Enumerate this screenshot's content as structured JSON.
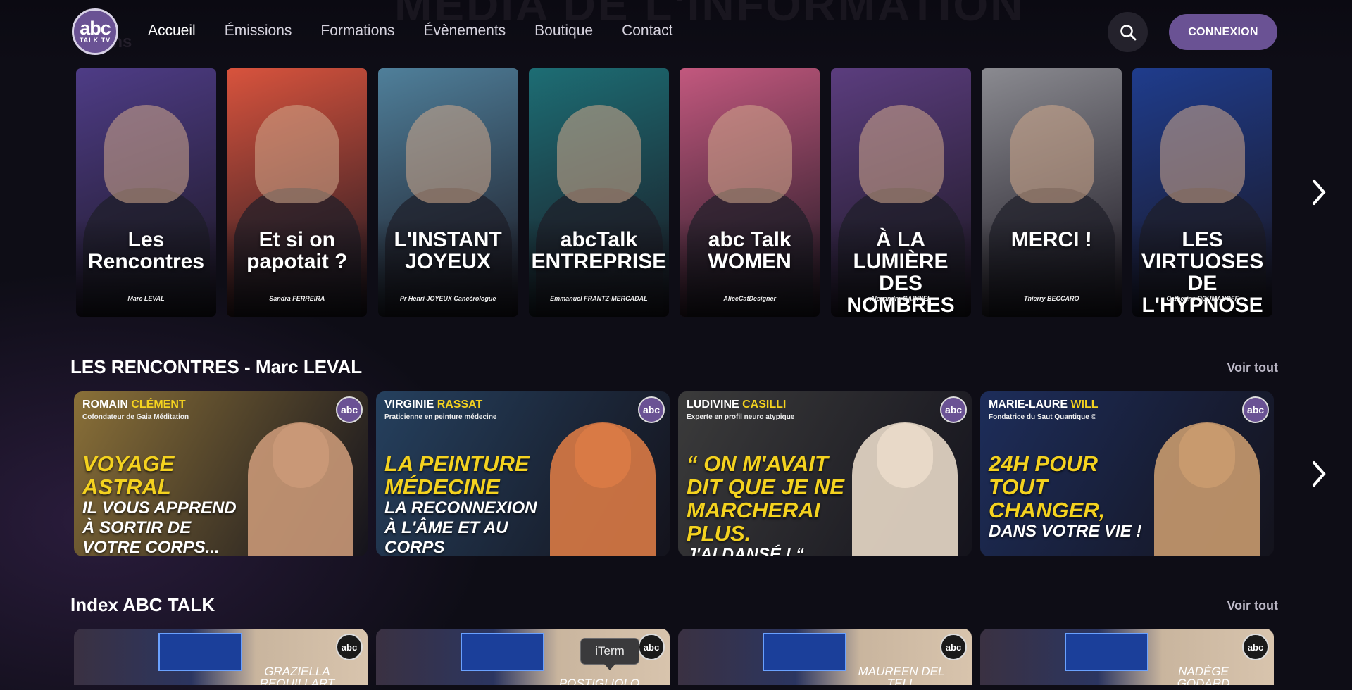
{
  "header": {
    "ghost_title": "MEDIA DE L'INFORMATION",
    "ghost_subtitle": "ions",
    "logo": {
      "main": "abc",
      "sub": "TALK TV"
    },
    "nav": [
      {
        "label": "Accueil",
        "active": true
      },
      {
        "label": "Émissions",
        "active": false
      },
      {
        "label": "Formations",
        "active": false
      },
      {
        "label": "Évènements",
        "active": false
      },
      {
        "label": "Boutique",
        "active": false
      },
      {
        "label": "Contact",
        "active": false
      }
    ],
    "search_icon": "search-icon",
    "login_label": "CONNEXION",
    "accent_color": "#6a5294"
  },
  "hosts": [
    {
      "show": "Les Rencontres",
      "host": "Marc LEVAL",
      "bg": "#4e3c86"
    },
    {
      "show": "Et si on papotait ?",
      "host": "Sandra FERREIRA",
      "bg": "#d8533d"
    },
    {
      "show": "L'INSTANT JOYEUX",
      "host": "Pr Henri JOYEUX Cancérologue",
      "bg": "#4f7f9a"
    },
    {
      "show": "abcTalk ENTREPRISE",
      "host": "Emmanuel FRANTZ-MERCADAL",
      "bg": "#1d6d74"
    },
    {
      "show": "abc Talk WOMEN",
      "host": "AliceCatDesigner",
      "bg": "#c2587e"
    },
    {
      "show": "À LA LUMIÈRE DES NOMBRES",
      "host": "Alexandra GABRIEL",
      "bg": "#5b3d7e"
    },
    {
      "show": "MERCI !",
      "host": "Thierry BECCARO",
      "bg": "#8a8a90"
    },
    {
      "show": "LES VIRTUOSES DE L'HYPNOSE",
      "host": "Catherine ROUMANOFF",
      "bg": "#1f3c8c"
    }
  ],
  "sections": [
    {
      "title": "LES RENCONTRES - Marc LEVAL",
      "see_all": "Voir tout",
      "items": [
        {
          "first": "ROMAIN",
          "last": "CLÉMENT",
          "role": "Cofondateur de Gaia Méditation",
          "line1": "VOYAGE ASTRAL",
          "line2": "IL VOUS APPREND À SORTIR DE VOTRE CORPS...",
          "bg": "#8a7038",
          "skin": "#c99877",
          "badge": "abc"
        },
        {
          "first": "VIRGINIE",
          "last": "RASSAT",
          "role": "Praticienne en peinture médecine",
          "line1": "LA PEINTURE MÉDECINE",
          "line2": "LA RECONNEXION À L'ÂME ET AU CORPS",
          "bg": "#25405e",
          "skin": "#d97a45",
          "badge": "abc"
        },
        {
          "first": "LUDIVINE",
          "last": "CASILLI",
          "role": "Experte en profil neuro atypique",
          "line1": "“ ON M'AVAIT DIT QUE JE NE MARCHERAI PLUS.",
          "line2": "J'AI DANSÉ ! “",
          "bg": "#3b3b3b",
          "skin": "#e8d9c8",
          "badge": "abc"
        },
        {
          "first": "MARIE-LAURE",
          "last": "WILL",
          "role": "Fondatrice du Saut Quantique ©",
          "line1": "24H POUR TOUT CHANGER,",
          "line2": "dans votre Vie !",
          "bg": "#1d2d5a",
          "skin": "#c89a6e",
          "badge": "abc"
        }
      ]
    },
    {
      "title": "Index ABC TALK",
      "see_all": "Voir tout",
      "items": [
        {
          "name": "GRAZIELLA REQUILLART",
          "badge": "abc"
        },
        {
          "name": "POSTIGLIOLO",
          "badge": "abc"
        },
        {
          "name": "MAUREEN DEL TELL",
          "badge": "abc"
        },
        {
          "name": "NADÈGE GODARD",
          "badge": "abc"
        }
      ]
    }
  ],
  "tooltip": "iTerm"
}
